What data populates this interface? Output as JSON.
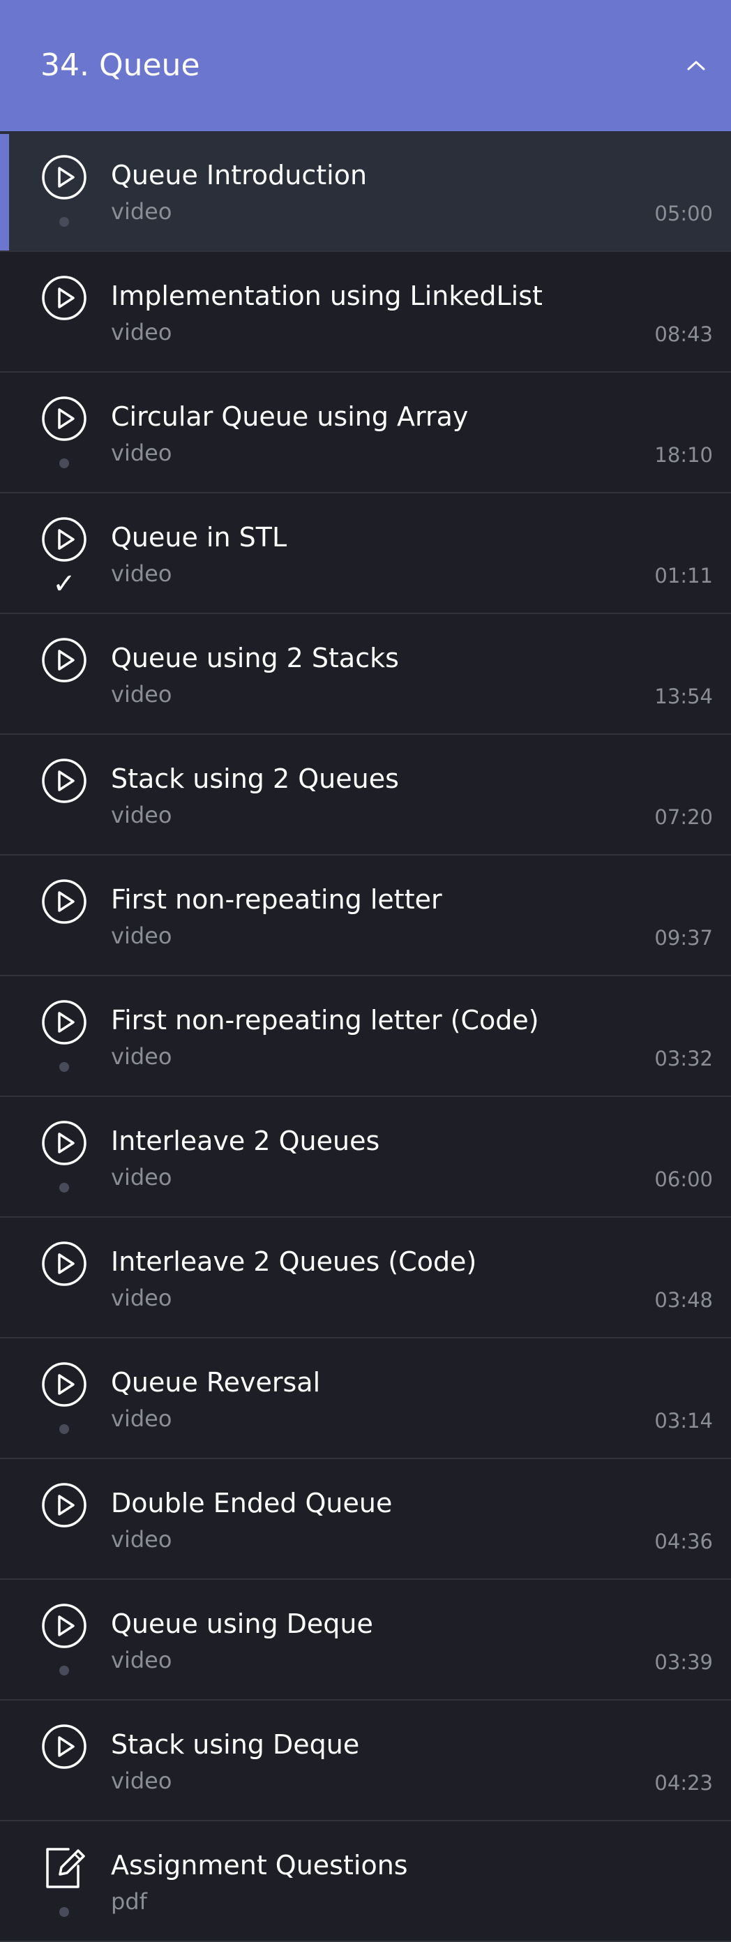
{
  "section": {
    "title": "34. Queue",
    "toggle_icon": "chevron-up-icon"
  },
  "colors": {
    "header_bg": "#6b76cf",
    "page_bg": "#1e1f26",
    "active_bg": "#2b2f3a",
    "accent": "#6b76cf",
    "muted_text": "#8c8e96"
  },
  "lectures": [
    {
      "title": "Queue Introduction",
      "type": "video",
      "duration": "05:00",
      "status": "dot",
      "icon": "play-icon",
      "active": true
    },
    {
      "title": "Implementation using LinkedList",
      "type": "video",
      "duration": "08:43",
      "status": "none",
      "icon": "play-icon",
      "active": false
    },
    {
      "title": "Circular Queue using Array",
      "type": "video",
      "duration": "18:10",
      "status": "dot",
      "icon": "play-icon",
      "active": false
    },
    {
      "title": "Queue in STL",
      "type": "video",
      "duration": "01:11",
      "status": "check",
      "icon": "play-icon",
      "active": false
    },
    {
      "title": "Queue using 2 Stacks",
      "type": "video",
      "duration": "13:54",
      "status": "none",
      "icon": "play-icon",
      "active": false
    },
    {
      "title": "Stack using 2 Queues",
      "type": "video",
      "duration": "07:20",
      "status": "none",
      "icon": "play-icon",
      "active": false
    },
    {
      "title": "First non-repeating letter",
      "type": "video",
      "duration": "09:37",
      "status": "none",
      "icon": "play-icon",
      "active": false
    },
    {
      "title": "First non-repeating letter (Code)",
      "type": "video",
      "duration": "03:32",
      "status": "dot",
      "icon": "play-icon",
      "active": false
    },
    {
      "title": "Interleave 2 Queues",
      "type": "video",
      "duration": "06:00",
      "status": "dot",
      "icon": "play-icon",
      "active": false
    },
    {
      "title": "Interleave 2 Queues (Code)",
      "type": "video",
      "duration": "03:48",
      "status": "none",
      "icon": "play-icon",
      "active": false
    },
    {
      "title": "Queue Reversal",
      "type": "video",
      "duration": "03:14",
      "status": "dot",
      "icon": "play-icon",
      "active": false
    },
    {
      "title": "Double Ended Queue",
      "type": "video",
      "duration": "04:36",
      "status": "none",
      "icon": "play-icon",
      "active": false
    },
    {
      "title": "Queue using Deque",
      "type": "video",
      "duration": "03:39",
      "status": "dot",
      "icon": "play-icon",
      "active": false
    },
    {
      "title": "Stack using Deque",
      "type": "video",
      "duration": "04:23",
      "status": "none",
      "icon": "play-icon",
      "active": false
    },
    {
      "title": "Assignment Questions",
      "type": "pdf",
      "duration": "",
      "status": "dot",
      "icon": "edit-document-icon",
      "active": false
    }
  ]
}
